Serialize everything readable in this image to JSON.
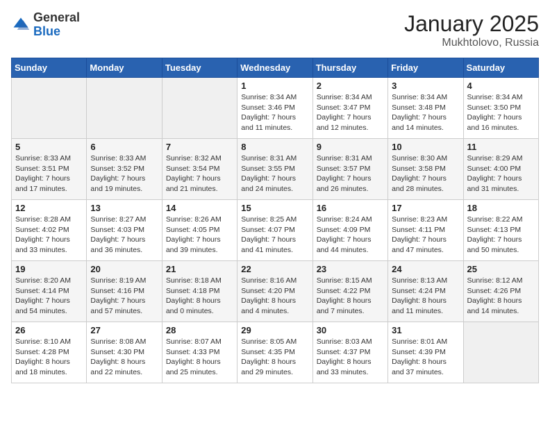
{
  "logo": {
    "general": "General",
    "blue": "Blue"
  },
  "title": {
    "month": "January 2025",
    "location": "Mukhtolovo, Russia"
  },
  "headers": [
    "Sunday",
    "Monday",
    "Tuesday",
    "Wednesday",
    "Thursday",
    "Friday",
    "Saturday"
  ],
  "weeks": [
    [
      {
        "num": "",
        "info": ""
      },
      {
        "num": "",
        "info": ""
      },
      {
        "num": "",
        "info": ""
      },
      {
        "num": "1",
        "info": "Sunrise: 8:34 AM\nSunset: 3:46 PM\nDaylight: 7 hours\nand 11 minutes."
      },
      {
        "num": "2",
        "info": "Sunrise: 8:34 AM\nSunset: 3:47 PM\nDaylight: 7 hours\nand 12 minutes."
      },
      {
        "num": "3",
        "info": "Sunrise: 8:34 AM\nSunset: 3:48 PM\nDaylight: 7 hours\nand 14 minutes."
      },
      {
        "num": "4",
        "info": "Sunrise: 8:34 AM\nSunset: 3:50 PM\nDaylight: 7 hours\nand 16 minutes."
      }
    ],
    [
      {
        "num": "5",
        "info": "Sunrise: 8:33 AM\nSunset: 3:51 PM\nDaylight: 7 hours\nand 17 minutes."
      },
      {
        "num": "6",
        "info": "Sunrise: 8:33 AM\nSunset: 3:52 PM\nDaylight: 7 hours\nand 19 minutes."
      },
      {
        "num": "7",
        "info": "Sunrise: 8:32 AM\nSunset: 3:54 PM\nDaylight: 7 hours\nand 21 minutes."
      },
      {
        "num": "8",
        "info": "Sunrise: 8:31 AM\nSunset: 3:55 PM\nDaylight: 7 hours\nand 24 minutes."
      },
      {
        "num": "9",
        "info": "Sunrise: 8:31 AM\nSunset: 3:57 PM\nDaylight: 7 hours\nand 26 minutes."
      },
      {
        "num": "10",
        "info": "Sunrise: 8:30 AM\nSunset: 3:58 PM\nDaylight: 7 hours\nand 28 minutes."
      },
      {
        "num": "11",
        "info": "Sunrise: 8:29 AM\nSunset: 4:00 PM\nDaylight: 7 hours\nand 31 minutes."
      }
    ],
    [
      {
        "num": "12",
        "info": "Sunrise: 8:28 AM\nSunset: 4:02 PM\nDaylight: 7 hours\nand 33 minutes."
      },
      {
        "num": "13",
        "info": "Sunrise: 8:27 AM\nSunset: 4:03 PM\nDaylight: 7 hours\nand 36 minutes."
      },
      {
        "num": "14",
        "info": "Sunrise: 8:26 AM\nSunset: 4:05 PM\nDaylight: 7 hours\nand 39 minutes."
      },
      {
        "num": "15",
        "info": "Sunrise: 8:25 AM\nSunset: 4:07 PM\nDaylight: 7 hours\nand 41 minutes."
      },
      {
        "num": "16",
        "info": "Sunrise: 8:24 AM\nSunset: 4:09 PM\nDaylight: 7 hours\nand 44 minutes."
      },
      {
        "num": "17",
        "info": "Sunrise: 8:23 AM\nSunset: 4:11 PM\nDaylight: 7 hours\nand 47 minutes."
      },
      {
        "num": "18",
        "info": "Sunrise: 8:22 AM\nSunset: 4:13 PM\nDaylight: 7 hours\nand 50 minutes."
      }
    ],
    [
      {
        "num": "19",
        "info": "Sunrise: 8:20 AM\nSunset: 4:14 PM\nDaylight: 7 hours\nand 54 minutes."
      },
      {
        "num": "20",
        "info": "Sunrise: 8:19 AM\nSunset: 4:16 PM\nDaylight: 7 hours\nand 57 minutes."
      },
      {
        "num": "21",
        "info": "Sunrise: 8:18 AM\nSunset: 4:18 PM\nDaylight: 8 hours\nand 0 minutes."
      },
      {
        "num": "22",
        "info": "Sunrise: 8:16 AM\nSunset: 4:20 PM\nDaylight: 8 hours\nand 4 minutes."
      },
      {
        "num": "23",
        "info": "Sunrise: 8:15 AM\nSunset: 4:22 PM\nDaylight: 8 hours\nand 7 minutes."
      },
      {
        "num": "24",
        "info": "Sunrise: 8:13 AM\nSunset: 4:24 PM\nDaylight: 8 hours\nand 11 minutes."
      },
      {
        "num": "25",
        "info": "Sunrise: 8:12 AM\nSunset: 4:26 PM\nDaylight: 8 hours\nand 14 minutes."
      }
    ],
    [
      {
        "num": "26",
        "info": "Sunrise: 8:10 AM\nSunset: 4:28 PM\nDaylight: 8 hours\nand 18 minutes."
      },
      {
        "num": "27",
        "info": "Sunrise: 8:08 AM\nSunset: 4:30 PM\nDaylight: 8 hours\nand 22 minutes."
      },
      {
        "num": "28",
        "info": "Sunrise: 8:07 AM\nSunset: 4:33 PM\nDaylight: 8 hours\nand 25 minutes."
      },
      {
        "num": "29",
        "info": "Sunrise: 8:05 AM\nSunset: 4:35 PM\nDaylight: 8 hours\nand 29 minutes."
      },
      {
        "num": "30",
        "info": "Sunrise: 8:03 AM\nSunset: 4:37 PM\nDaylight: 8 hours\nand 33 minutes."
      },
      {
        "num": "31",
        "info": "Sunrise: 8:01 AM\nSunset: 4:39 PM\nDaylight: 8 hours\nand 37 minutes."
      },
      {
        "num": "",
        "info": ""
      }
    ]
  ]
}
